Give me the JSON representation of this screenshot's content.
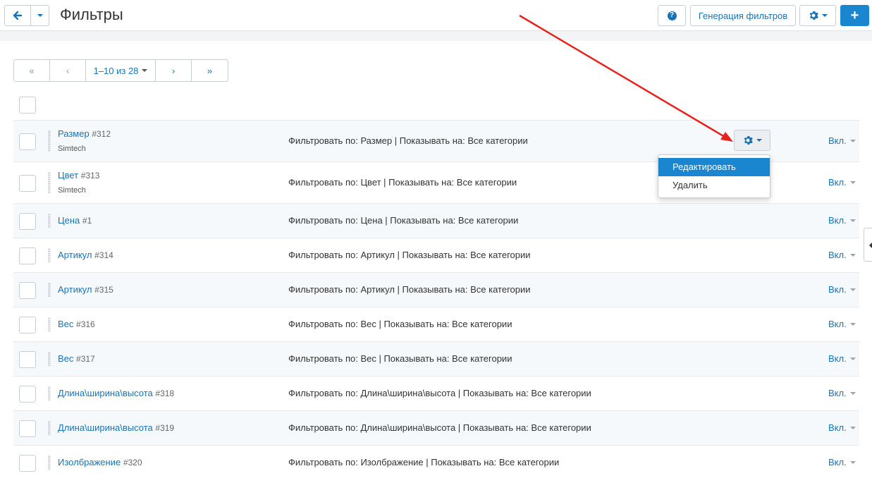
{
  "header": {
    "title": "Фильтры",
    "generate_label": "Генерация фильтров",
    "help_glyph": "?",
    "add_glyph": "+"
  },
  "pagination": {
    "first": "«",
    "prev": "‹",
    "range": "1–10 из 28",
    "next": "›",
    "last": "»"
  },
  "dropdown": {
    "items": [
      "Редактировать",
      "Удалить"
    ]
  },
  "rows": [
    {
      "name": "Размер",
      "id": "#312",
      "company": "Simtech",
      "desc": "Фильтровать по: Размер | Показывать на: Все категории",
      "status": "Вкл."
    },
    {
      "name": "Цвет",
      "id": "#313",
      "company": "Simtech",
      "desc": "Фильтровать по: Цвет | Показывать на: Все категории",
      "status": "Вкл."
    },
    {
      "name": "Цена",
      "id": "#1",
      "company": "",
      "desc": "Фильтровать по: Цена | Показывать на: Все категории",
      "status": "Вкл."
    },
    {
      "name": "Артикул",
      "id": "#314",
      "company": "",
      "desc": "Фильтровать по: Артикул | Показывать на: Все категории",
      "status": "Вкл."
    },
    {
      "name": "Артикул",
      "id": "#315",
      "company": "",
      "desc": "Фильтровать по: Артикул | Показывать на: Все категории",
      "status": "Вкл."
    },
    {
      "name": "Вес",
      "id": "#316",
      "company": "",
      "desc": "Фильтровать по: Вес | Показывать на: Все категории",
      "status": "Вкл."
    },
    {
      "name": "Вес",
      "id": "#317",
      "company": "",
      "desc": "Фильтровать по: Вес | Показывать на: Все категории",
      "status": "Вкл."
    },
    {
      "name": "Длина\\ширина\\высота",
      "id": "#318",
      "company": "",
      "desc": "Фильтровать по: Длина\\ширина\\высота | Показывать на: Все категории",
      "status": "Вкл."
    },
    {
      "name": "Длина\\ширина\\высота",
      "id": "#319",
      "company": "",
      "desc": "Фильтровать по: Длина\\ширина\\высота | Показывать на: Все категории",
      "status": "Вкл."
    },
    {
      "name": "Изолбражение",
      "id": "#320",
      "company": "",
      "desc": "Фильтровать по: Изолбражение | Показывать на: Все категории",
      "status": "Вкл."
    }
  ],
  "colors": {
    "accent": "#1a86d0",
    "link": "#1a73b5",
    "arrow": "#e8231e"
  }
}
